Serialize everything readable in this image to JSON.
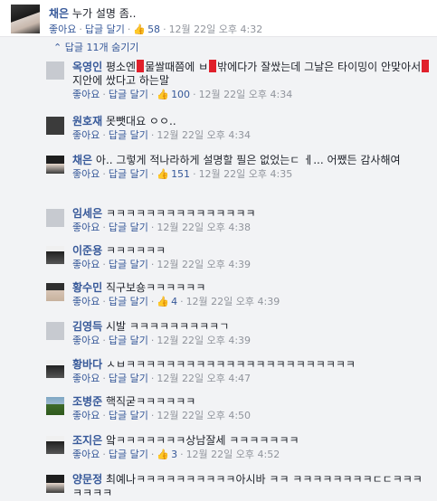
{
  "top_comment": {
    "author": "채은",
    "text": "누가 설명 좀..",
    "like": "좋아요",
    "reply": "답글 달기",
    "likes": "58",
    "time": "12월 22일 오후 4:32"
  },
  "hide_replies": "답글 11개 숨기기",
  "replies": [
    {
      "author": "옥영인",
      "text_parts": [
        "평소엔",
        "물쌀때쯤에 ㅂ",
        "밖에다가 잘쌌는데 그날은 타이밍이 안맞아서",
        "지안에 쌌다고 하는말"
      ],
      "like": "좋아요",
      "reply": "답글 달기",
      "likes": "100",
      "time": "12월 22일 오후 4:34"
    },
    {
      "author": "원호재",
      "text": "못뺏대요 ㅇㅇ..",
      "like": "좋아요",
      "reply": "답글 달기",
      "likes": "",
      "time": "12월 22일 오후 4:34"
    },
    {
      "author": "채은",
      "text": "아.. 그렇게 적나라하게 설명할 필은 없었는ㄷ ㅔ... 어쨌든 감사해여",
      "like": "좋아요",
      "reply": "답글 달기",
      "likes": "151",
      "time": "12월 22일 오후 4:35"
    },
    {
      "author": "임세은",
      "text": "ㅋㅋㅋㅋㅋㅋㅋㅋㅋㅋㅋㅋㅋㅋㅋ",
      "like": "좋아요",
      "reply": "답글 달기",
      "likes": "",
      "time": "12월 22일 오후 4:38"
    },
    {
      "author": "이준용",
      "text": "ㅋㅋㅋㅋㅋㅋ",
      "like": "좋아요",
      "reply": "답글 달기",
      "likes": "",
      "time": "12월 22일 오후 4:39"
    },
    {
      "author": "황수민",
      "text": "직구보숑ㅋㅋㅋㅋㅋㅋ",
      "like": "좋아요",
      "reply": "답글 달기",
      "likes": "4",
      "time": "12월 22일 오후 4:39"
    },
    {
      "author": "김영득",
      "text": "시발 ㅋㅋㅋㅋㅋㅋㅋㅋㅋㄱ",
      "like": "좋아요",
      "reply": "답글 달기",
      "likes": "",
      "time": "12월 22일 오후 4:39"
    },
    {
      "author": "황바다",
      "text": "ㅅㅂㅋㅋㅋㅋㅋㅋㅋㅋㅋㅋㅋㅋㅋㅋㅋㅋㅋㅋㅋㅋㅋㅋㅋ",
      "like": "좋아요",
      "reply": "답글 달기",
      "likes": "",
      "time": "12월 22일 오후 4:47"
    },
    {
      "author": "조병준",
      "text": "핵직굳ㅋㅋㅋㅋㅋㅋ",
      "like": "좋아요",
      "reply": "답글 달기",
      "likes": "",
      "time": "12월 22일 오후 4:50"
    },
    {
      "author": "조지은",
      "text": "앜ㅋㅋㅋㅋㅋㅋㅋ상남잘세 ㅋㅋㅋㅋㅋㅋㅋ",
      "like": "좋아요",
      "reply": "답글 달기",
      "likes": "3",
      "time": "12월 22일 오후 4:52"
    },
    {
      "author": "양문정",
      "text": "최예나ㅋㅋㅋㅋㅋㅋㅋㅋㅋㅋ아시바 ㅋㅋ ㅋㅋㅋㅋㅋㅋㅋㅋㄷㄷㅋㅋㅋ ㅋㅋㅋㅋ"
    }
  ]
}
